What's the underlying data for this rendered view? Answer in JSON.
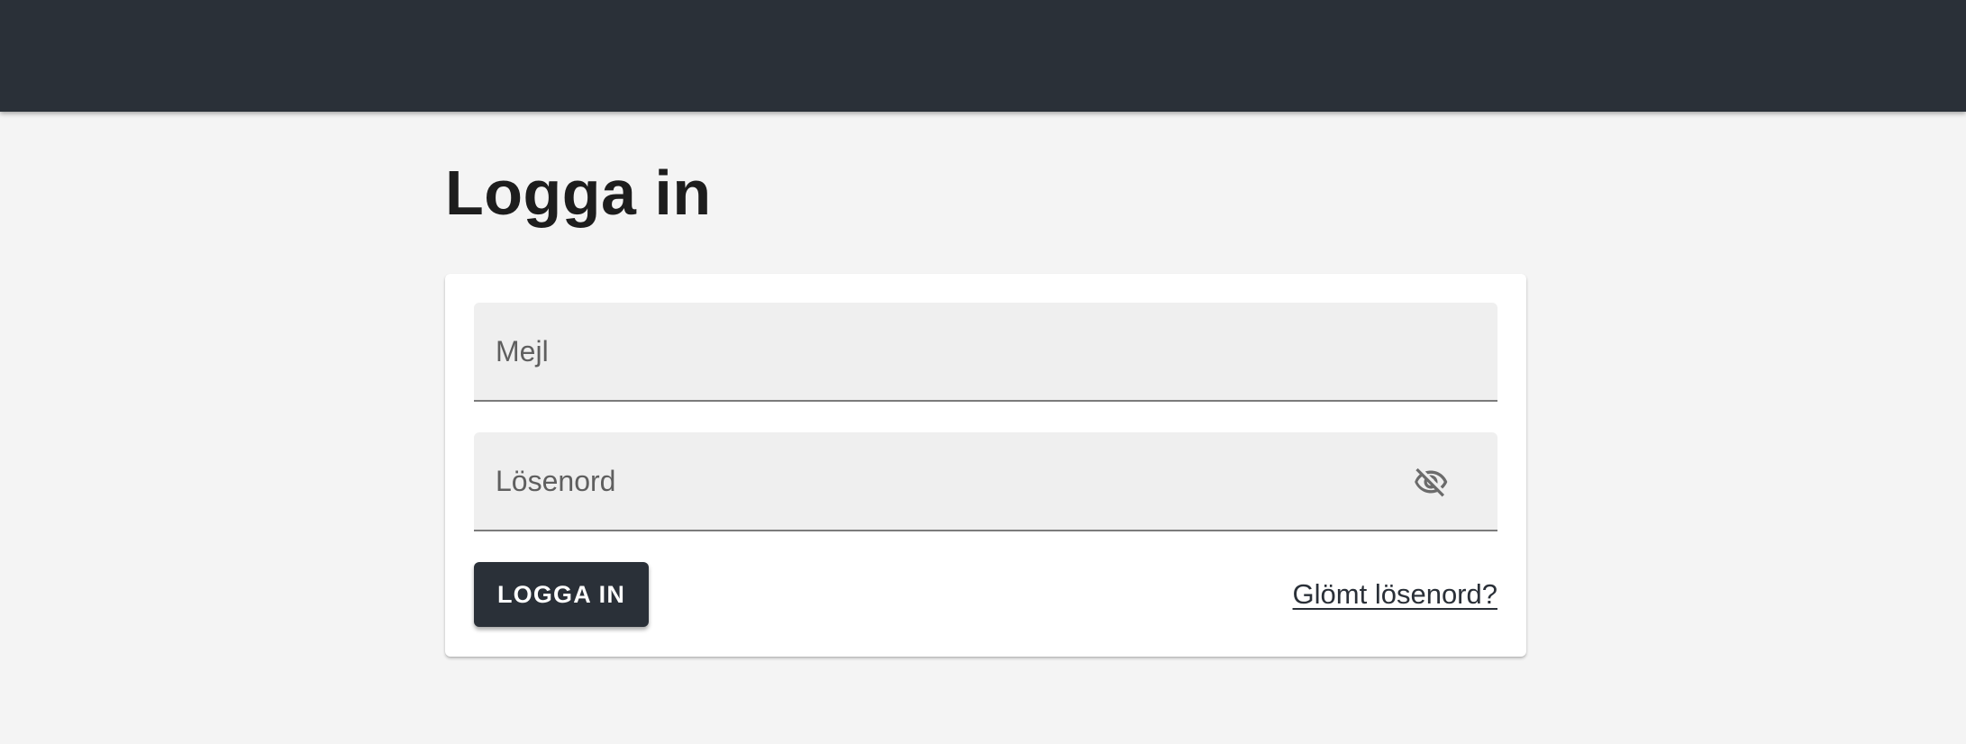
{
  "header": {
    "background_color": "#2a3038"
  },
  "page": {
    "title": "Logga in"
  },
  "form": {
    "email": {
      "value": "",
      "placeholder": "Mejl"
    },
    "password": {
      "value": "",
      "placeholder": "Lösenord",
      "visibility_icon": "visibility-off-icon"
    },
    "submit_label": "LOGGA IN",
    "forgot_password_label": "Glömt lösenord?"
  },
  "colors": {
    "page_background": "#f4f4f4",
    "primary": "#2a3038",
    "field_background": "#efefef"
  }
}
